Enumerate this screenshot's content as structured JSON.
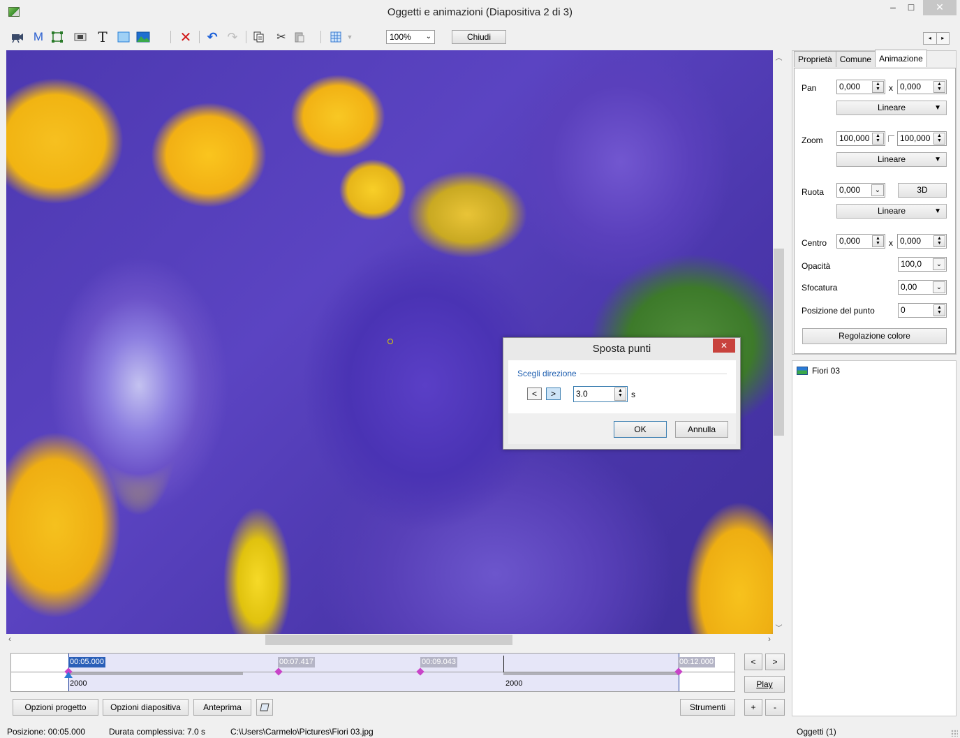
{
  "window": {
    "title": "Oggetti e animazioni  (Diapositiva 2 di 3)",
    "min_glyph": "–",
    "max_glyph": "□",
    "close_glyph": "✕"
  },
  "toolbar": {
    "zoom_value": "100%",
    "close_button": "Chiudi",
    "icons": [
      "camera-icon",
      "mask-icon",
      "frame-icon",
      "button-icon",
      "text-icon",
      "rectangle-icon",
      "image-icon",
      "delete-icon",
      "undo-icon",
      "redo-icon",
      "copy-icon",
      "cut-icon",
      "paste-icon",
      "grid-icon"
    ]
  },
  "tabs": [
    {
      "label": "Proprietà"
    },
    {
      "label": "Comune"
    },
    {
      "label": "Animazione"
    }
  ],
  "animation": {
    "pan_label": "Pan",
    "pan_x": "0,000",
    "pan_y": "0,000",
    "pan_mode": "Lineare",
    "x_sep": "x",
    "zoom_label": "Zoom",
    "zoom_x": "100,000",
    "zoom_y": "100,000",
    "zoom_mode": "Lineare",
    "rotate_label": "Ruota",
    "rotate_value": "0,000",
    "rotate_3d": "3D",
    "rotate_mode": "Lineare",
    "center_label": "Centro",
    "center_x": "0,000",
    "center_y": "0,000",
    "opacity_label": "Opacità",
    "opacity_value": "100,0",
    "blur_label": "Sfocatura",
    "blur_value": "0,00",
    "point_pos_label": "Posizione del punto",
    "point_pos_value": "0",
    "color_adjust": "Regolazione colore"
  },
  "objects": {
    "items": [
      "Fiori 03"
    ],
    "count_label": "Oggetti (1)"
  },
  "dialog": {
    "title": "Sposta punti",
    "close_glyph": "✕",
    "group_label": "Scegli direzione",
    "left_glyph": "<",
    "right_glyph": ">",
    "value": "3.0",
    "unit": "s",
    "ok": "OK",
    "cancel": "Annulla"
  },
  "timeline": {
    "times": [
      "00:05.000",
      "00:07.417",
      "00:09.043",
      "00:12.000"
    ],
    "values": [
      "2000",
      "2000"
    ]
  },
  "nav": {
    "prev": "<",
    "next": ">",
    "play": "Play",
    "plus": "+",
    "minus": "-"
  },
  "bottom_buttons": {
    "project_options": "Opzioni progetto",
    "slide_options": "Opzioni diapositiva",
    "preview": "Anteprima",
    "tools": "Strumenti"
  },
  "status": {
    "position": "Posizione:  00:05.000",
    "duration": "Durata complessiva:  7.0 s",
    "path": "C:\\Users\\Carmelo\\Pictures\\Fiori 03.jpg"
  }
}
